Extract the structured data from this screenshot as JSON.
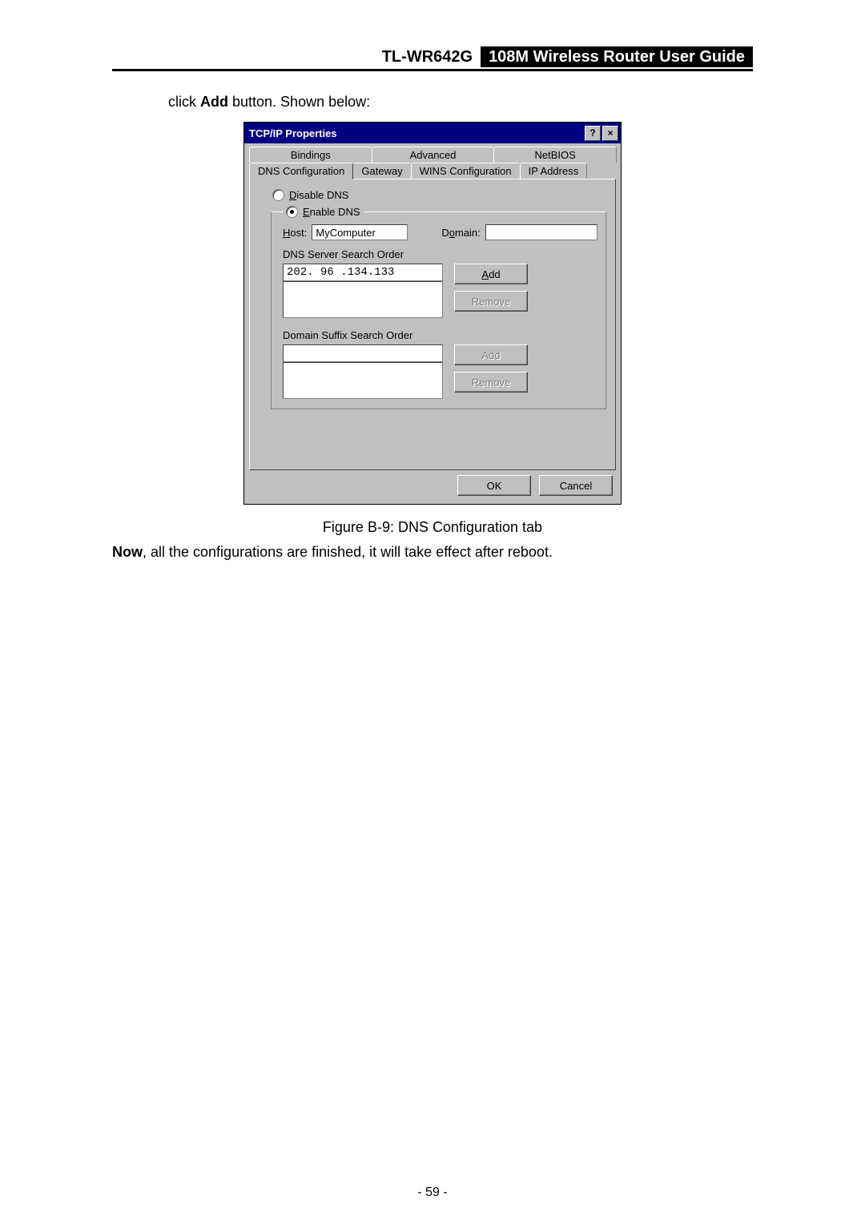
{
  "header": {
    "model": "TL-WR642G",
    "title": "108M  Wireless  Router  User  Guide"
  },
  "intro": {
    "prefix": "click ",
    "bold": "Add",
    "suffix": " button. Shown below:"
  },
  "dialog": {
    "title": "TCP/IP Properties",
    "help": "?",
    "close": "×",
    "tabs_row1": [
      "Bindings",
      "Advanced",
      "NetBIOS"
    ],
    "tabs_row2": [
      "DNS Configuration",
      "Gateway",
      "WINS Configuration",
      "IP Address"
    ],
    "active_tab": "DNS Configuration",
    "radio_disable": "Disable DNS",
    "radio_enable": "Enable DNS",
    "radio_selected": "enable",
    "host_label": "Host:",
    "host_value": "MyComputer",
    "domain_label": "Domain:",
    "domain_value": "",
    "dns_search_label": "DNS Server Search Order",
    "dns_input_value": "202. 96 .134.133",
    "add_label": "Add",
    "remove_label": "Remove",
    "domain_suffix_label": "Domain Suffix Search Order",
    "domain_suffix_input": "",
    "ok_label": "OK",
    "cancel_label": "Cancel"
  },
  "caption": "Figure B-9: DNS Configuration tab",
  "after": {
    "bold": "Now",
    "rest": ", all the configurations are finished, it will take effect after reboot."
  },
  "page_number": "- 59 -"
}
